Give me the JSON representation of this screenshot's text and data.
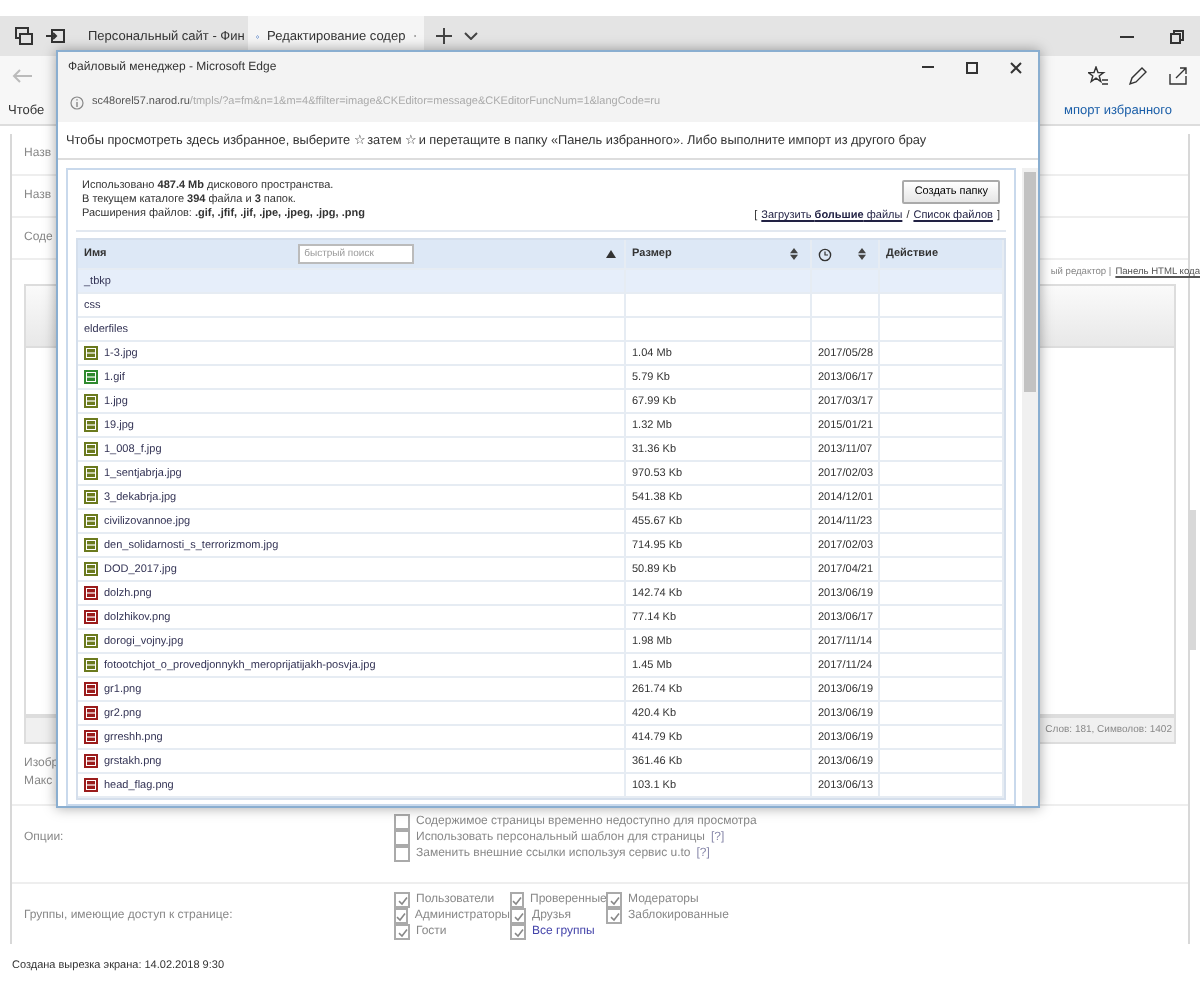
{
  "browser": {
    "tabs": [
      {
        "label": "Персональный сайт - Фин",
        "selected": false
      },
      {
        "label": "Редактирование содер",
        "selected": true
      }
    ],
    "favorites_hint": "Чтобе",
    "import_link": "мпорт избранного"
  },
  "page": {
    "field_labels": [
      "Назв",
      "Назв",
      "Соде"
    ],
    "editor_mode": "ый редактор |",
    "html_link": "Панель HTML кода",
    "word_count": "Слов: 181, Символов: 1402",
    "image_label": "Изобр",
    "max_label": "Макс",
    "options": {
      "label": "Опции:",
      "items": [
        {
          "text": "Содержимое страницы временно недоступно для просмотра",
          "checked": false
        },
        {
          "text": "Использовать персональный шаблон для страницы",
          "help": "[?]",
          "checked": false
        },
        {
          "text": "Заменить внешние ссылки используя сервис u.to",
          "help": "[?]",
          "checked": false
        }
      ]
    },
    "groups": {
      "label": "Группы, имеющие доступ к странице:",
      "items": [
        {
          "text": "Пользователи",
          "checked": true,
          "kind": "plain"
        },
        {
          "text": "Проверенные",
          "checked": true,
          "kind": "plain"
        },
        {
          "text": "Модераторы",
          "checked": true,
          "kind": "plain"
        },
        {
          "text": "Администраторы",
          "checked": true,
          "kind": "plain"
        },
        {
          "text": "Друзья",
          "checked": true,
          "kind": "plain"
        },
        {
          "text": "Заблокированные",
          "checked": true,
          "kind": "plain"
        },
        {
          "text": "Гости",
          "checked": true,
          "kind": "plain"
        },
        {
          "text": "Все группы",
          "checked": true,
          "kind": "link"
        }
      ]
    }
  },
  "footer": "Создана вырезка экрана: 14.02.2018 9:30",
  "popup": {
    "title": "Файловый менеджер - Microsoft Edge",
    "address_domain": "sc48orel57.narod.ru",
    "address_path": "/tmpls/?a=fm&n=1&m=4&ffilter=image&CKEditor=message&CKEditorFuncNum=1&langCode=ru",
    "favorites_hint": "Чтобы просмотреть здесь избранное, выберите ☆ затем ☆ и перетащите в папку «Панель избранного». Либо выполните импорт из другого брау",
    "usage": "Использовано **487.4 Mb** дискового пространства.",
    "counts": "В текущем каталоге **394** файла и **3** папок.",
    "extensions": "Расширения файлов: **.gif, .jfif, .jif, .jpe, .jpeg, .jpg, .png**",
    "create_folder_button": "Создать папку",
    "bracket_open": "[",
    "upload_link": "Загрузить **большие** файлы",
    "link_separator": "/",
    "list_link": "Список файлов",
    "bracket_close": "]",
    "table": {
      "search_placeholder": "быстрый поиск",
      "columns": [
        {
          "kind": "text",
          "label": "Имя",
          "sortable": true,
          "sorted": true
        },
        {
          "kind": "text",
          "label": "Размер",
          "sortable": true,
          "sorted": false
        },
        {
          "kind": "clock",
          "sortable": true,
          "sorted": false
        },
        {
          "kind": "text",
          "label": "Действие",
          "sortable": false
        }
      ],
      "rows": [
        {
          "kind": "folder",
          "name": "_tbkp",
          "selected": true
        },
        {
          "kind": "folder",
          "name": "css",
          "selected": false
        },
        {
          "kind": "folder",
          "name": "elderfiles",
          "selected": false
        },
        {
          "kind": "jpg",
          "name": "1-3.jpg",
          "size": "1.04 Mb",
          "date": "2017/05/28",
          "selected": false
        },
        {
          "kind": "gif",
          "name": "1.gif",
          "size": "5.79 Kb",
          "date": "2013/06/17",
          "selected": false
        },
        {
          "kind": "jpg",
          "name": "1.jpg",
          "size": "67.99 Kb",
          "date": "2017/03/17",
          "selected": false
        },
        {
          "kind": "jpg",
          "name": "19.jpg",
          "size": "1.32 Mb",
          "date": "2015/01/21",
          "selected": false
        },
        {
          "kind": "jpg",
          "name": "1_008_f.jpg",
          "size": "31.36 Kb",
          "date": "2013/11/07",
          "selected": false
        },
        {
          "kind": "jpg",
          "name": "1_sentjabrja.jpg",
          "size": "970.53 Kb",
          "date": "2017/02/03",
          "selected": false
        },
        {
          "kind": "jpg",
          "name": "3_dekabrja.jpg",
          "size": "541.38 Kb",
          "date": "2014/12/01",
          "selected": false
        },
        {
          "kind": "jpg",
          "name": "civilizovannoe.jpg",
          "size": "455.67 Kb",
          "date": "2014/11/23",
          "selected": false
        },
        {
          "kind": "jpg",
          "name": "den_solidarnosti_s_terrorizmom.jpg",
          "size": "714.95 Kb",
          "date": "2017/02/03",
          "selected": false
        },
        {
          "kind": "jpg",
          "name": "DOD_2017.jpg",
          "size": "50.89 Kb",
          "date": "2017/04/21",
          "selected": false
        },
        {
          "kind": "png",
          "name": "dolzh.png",
          "size": "142.74 Kb",
          "date": "2013/06/19",
          "selected": false
        },
        {
          "kind": "png",
          "name": "dolzhikov.png",
          "size": "77.14 Kb",
          "date": "2013/06/17",
          "selected": false
        },
        {
          "kind": "jpg",
          "name": "dorogi_vojny.jpg",
          "size": "1.98 Mb",
          "date": "2017/11/14",
          "selected": false
        },
        {
          "kind": "jpg",
          "name": "fotootchjot_o_provedjonnykh_meroprijatijakh-posvja.jpg",
          "size": "1.45 Mb",
          "date": "2017/11/24",
          "selected": false
        },
        {
          "kind": "png",
          "name": "gr1.png",
          "size": "261.74 Kb",
          "date": "2013/06/19",
          "selected": false
        },
        {
          "kind": "png",
          "name": "gr2.png",
          "size": "420.4 Kb",
          "date": "2013/06/19",
          "selected": false
        },
        {
          "kind": "png",
          "name": "grreshh.png",
          "size": "414.79 Kb",
          "date": "2013/06/19",
          "selected": false
        },
        {
          "kind": "png",
          "name": "grstakh.png",
          "size": "361.46 Kb",
          "date": "2013/06/19",
          "selected": false
        },
        {
          "kind": "png",
          "name": "head_flag.png",
          "size": "103.1 Kb",
          "date": "2013/06/13",
          "selected": false
        }
      ]
    }
  }
}
